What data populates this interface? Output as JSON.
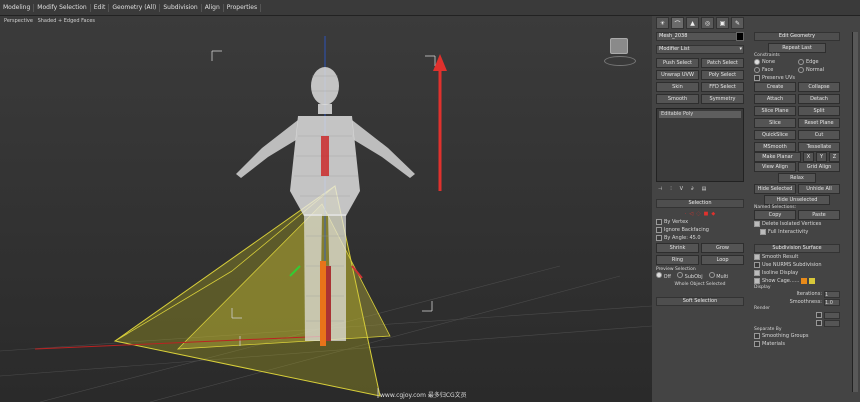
{
  "menu": [
    "Modeling",
    "Modify Selection",
    "Edit",
    "Geometry (All)",
    "Subdivision",
    "Align",
    "Properties"
  ],
  "viewport": {
    "label": [
      "Perspective",
      "Shaded + Edged Faces"
    ],
    "watermark": "www.cgjoy.com 最多归CG文员"
  },
  "panel": {
    "tabs": [
      "☀",
      "⌒",
      "▲",
      "◎",
      "▣",
      "✎"
    ],
    "object_name": "Mesh_2038",
    "modifier_list": "Modifier List",
    "modifier_buttons": [
      "Push Select",
      "Patch Select",
      "Unwrap UVW",
      "Poly Select",
      "Skin",
      "FFD Select",
      "Smooth",
      "Symmetry"
    ],
    "stack_item": "Editable Poly",
    "selection": {
      "header": "Selection",
      "options": [
        "By Vertex",
        "Ignore Backfacing",
        "By Angle: 45.0"
      ],
      "buttons": [
        "Shrink",
        "Grow",
        "Ring",
        "Loop"
      ],
      "preview_label": "Preview Selection",
      "preview_options": [
        "Off",
        "SubObj",
        "Multi"
      ],
      "whole": "Whole Object Selected"
    },
    "soft_selection": "Soft Selection",
    "edit_geometry": {
      "header": "Edit Geometry",
      "repeat": "Repeat Last",
      "constraints_label": "Constraints",
      "constraints": [
        "None",
        "Edge",
        "Face",
        "Normal"
      ],
      "preserve": "Preserve UVs",
      "buttons": [
        "Create",
        "Collapse",
        "Attach",
        "Detach",
        "Slice Plane",
        "Split",
        "Slice",
        "Reset Plane",
        "QuickSlice",
        "Cut",
        "MSmooth",
        "Tessellate",
        "Make Planar",
        "X",
        "Y",
        "Z",
        "View Align",
        "Grid Align",
        "Relax",
        "Hide Selected",
        "Unhide All",
        "Hide Unselected"
      ],
      "named": "Named Selections:",
      "copy": "Copy",
      "paste": "Paste",
      "delete_iso": "Delete Isolated Vertices",
      "full_inter": "Full Interactivity"
    },
    "subdivision": {
      "header": "Subdivision Surface",
      "options": [
        "Smooth Result",
        "Use NURMS Subdivision",
        "Isoline Display",
        "Show Cage......"
      ],
      "display": "Display",
      "iterations_label": "Iterations:",
      "iterations": "1",
      "smoothness_label": "Smoothness:",
      "smoothness": "1.0",
      "render": "Render",
      "separate": "Separate By",
      "sep_options": [
        "Smoothing Groups",
        "Materials"
      ]
    }
  },
  "colors": {
    "accent_red": "#e0312d",
    "cage_orange": "#e88a1a",
    "cage_yellow": "#d8c83a",
    "frustum": "#d8cf3a"
  }
}
